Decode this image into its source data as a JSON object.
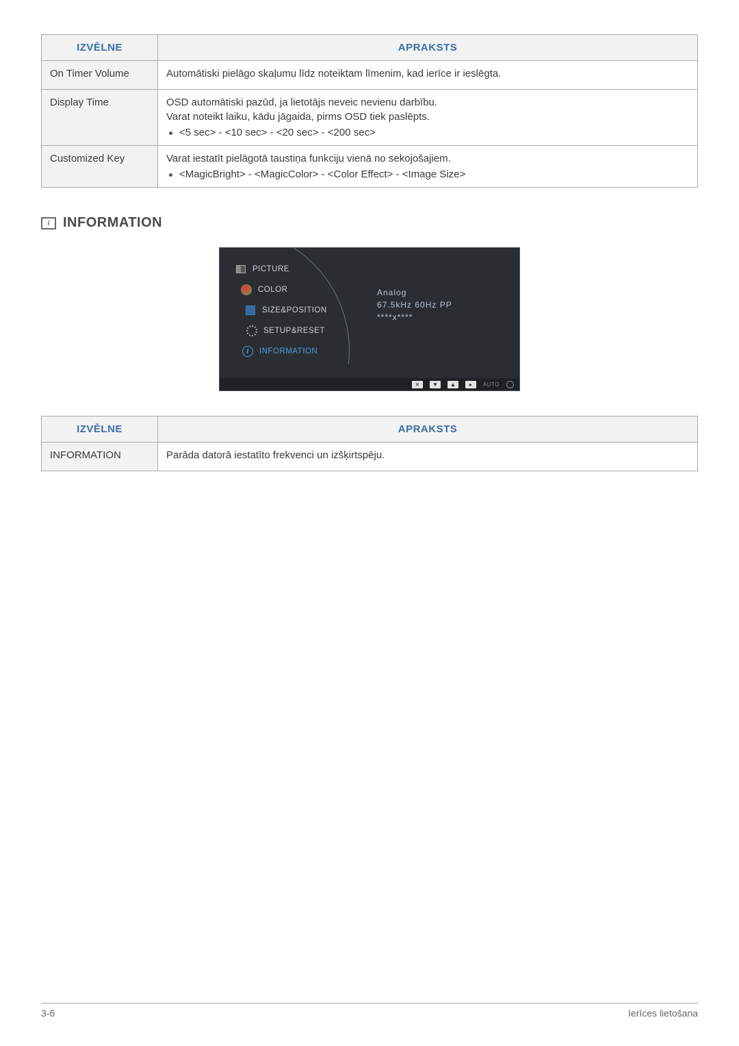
{
  "table1": {
    "headers": [
      "IZVĒLNE",
      "APRAKSTS"
    ],
    "rows": [
      {
        "menu": "On Timer Volume",
        "lines": [
          "Automātiski pielāgo skaļumu līdz noteiktam līmenim, kad ierīce ir ieslēgta."
        ],
        "bullets": []
      },
      {
        "menu": "Display Time",
        "lines": [
          "OSD automātiski pazūd, ja lietotājs neveic nevienu darbību.",
          "Varat noteikt laiku, kādu jāgaida, pirms OSD tiek paslēpts."
        ],
        "bullets": [
          "<5 sec> - <10 sec> - <20 sec> - <200 sec>"
        ]
      },
      {
        "menu": "Customized Key",
        "lines": [
          "Varat iestatīt pielāgotā taustiņa funkciju vienā no sekojošajiem."
        ],
        "bullets": [
          "<MagicBright> - <MagicColor> - <Color Effect> - <Image Size>"
        ]
      }
    ]
  },
  "section": {
    "title": "INFORMATION"
  },
  "osd": {
    "items": [
      {
        "label": "PICTURE",
        "icon": "picture"
      },
      {
        "label": "COLOR",
        "icon": "color"
      },
      {
        "label": "SIZE&POSITION",
        "icon": "sizepos"
      },
      {
        "label": "SETUP&RESET",
        "icon": "setup"
      },
      {
        "label": "INFORMATION",
        "icon": "info",
        "active": true
      }
    ],
    "info": {
      "l1": "Analog",
      "l2": "67.5kHz 60Hz PP",
      "l3": "****x****"
    },
    "footer": {
      "auto": "AUTO"
    }
  },
  "table2": {
    "headers": [
      "IZVĒLNE",
      "APRAKSTS"
    ],
    "rows": [
      {
        "menu": "INFORMATION",
        "lines": [
          "Parāda datorā iestatīto frekvenci un izšķirtspēju."
        ],
        "bullets": []
      }
    ]
  },
  "footer": {
    "left": "3-6",
    "right": "Ierīces lietošana"
  }
}
